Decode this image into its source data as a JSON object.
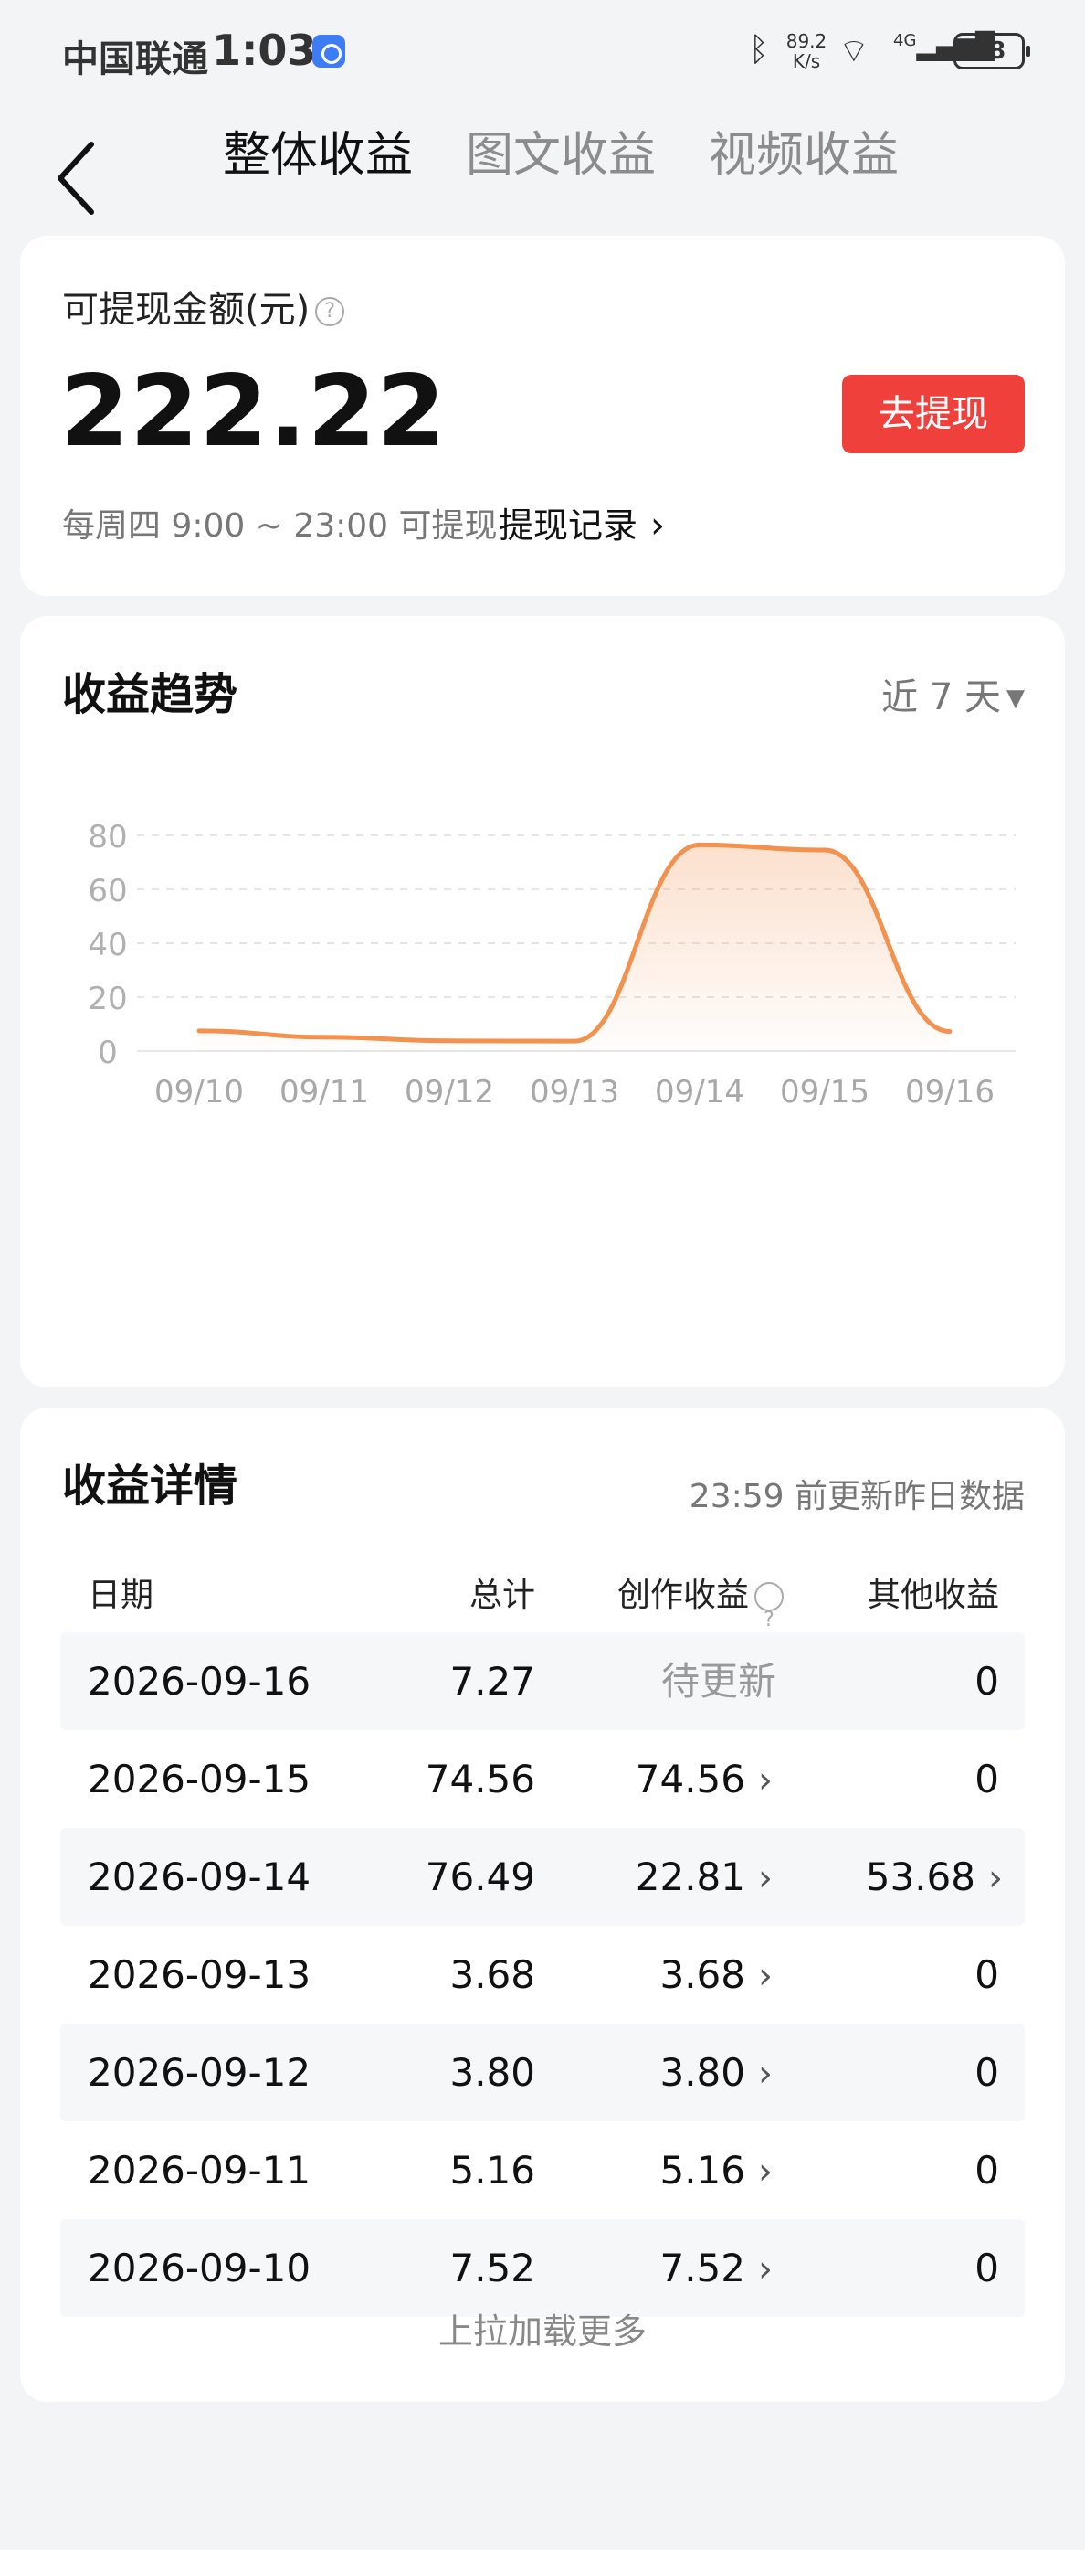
{
  "status_bar": {
    "carrier": "中国联通",
    "time": "1:03",
    "net_speed": "89.2 K/s",
    "network": "4G",
    "battery": "48"
  },
  "tabs": [
    {
      "label": "整体收益",
      "active": true
    },
    {
      "label": "图文收益",
      "active": false
    },
    {
      "label": "视频收益",
      "active": false
    }
  ],
  "balance": {
    "label": "可提现金额(元)",
    "amount": "222.22",
    "withdraw_button": "去提现",
    "note": "每周四 9:00 ~ 23:00 可提现",
    "record_link": "提现记录"
  },
  "trend": {
    "title": "收益趋势",
    "range_select": "近 7 天"
  },
  "chart_data": {
    "type": "area",
    "categories": [
      "09/10",
      "09/11",
      "09/12",
      "09/13",
      "09/14",
      "09/15",
      "09/16"
    ],
    "values": [
      7.52,
      5.16,
      3.8,
      3.68,
      76.49,
      74.56,
      7.27
    ],
    "ylim": [
      0,
      80
    ],
    "yticks": [
      0,
      20,
      40,
      60,
      80
    ],
    "grid": true,
    "color": "#f3914f"
  },
  "details": {
    "title": "收益详情",
    "note": "23:59 前更新昨日数据",
    "columns": [
      "日期",
      "总计",
      "创作收益",
      "其他收益"
    ],
    "rows": [
      {
        "date": "2026-09-16",
        "total": "7.27",
        "creation": "待更新",
        "other": "0"
      },
      {
        "date": "2026-09-15",
        "total": "74.56",
        "creation": "74.56",
        "other": "0"
      },
      {
        "date": "2026-09-14",
        "total": "76.49",
        "creation": "22.81",
        "other": "53.68"
      },
      {
        "date": "2026-09-13",
        "total": "3.68",
        "creation": "3.68",
        "other": "0"
      },
      {
        "date": "2026-09-12",
        "total": "3.80",
        "creation": "3.80",
        "other": "0"
      },
      {
        "date": "2026-09-11",
        "total": "5.16",
        "creation": "5.16",
        "other": "0"
      },
      {
        "date": "2026-09-10",
        "total": "7.52",
        "creation": "7.52",
        "other": "0"
      }
    ],
    "load_more": "上拉加载更多"
  }
}
